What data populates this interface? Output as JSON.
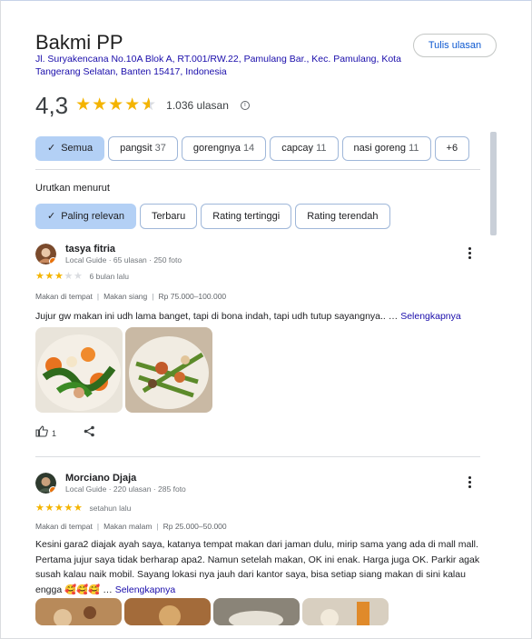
{
  "place": {
    "name": "Bakmi PP",
    "address": "Jl. Suryakencana No.10A Blok A, RT.001/RW.22, Pamulang Bar., Kec. Pamulang, Kota Tangerang Selatan, Banten 15417, Indonesia",
    "write_review_label": "Tulis ulasan",
    "rating": "4,3",
    "rating_value": 4.3,
    "review_count": "1.036 ulasan"
  },
  "filters": [
    {
      "label": "Semua",
      "count": "",
      "active": true
    },
    {
      "label": "pangsit",
      "count": "37"
    },
    {
      "label": "gorengnya",
      "count": "14"
    },
    {
      "label": "capcay",
      "count": "11"
    },
    {
      "label": "nasi goreng",
      "count": "11"
    },
    {
      "label": "+6",
      "count": ""
    }
  ],
  "sort": {
    "label": "Urutkan menurut",
    "options": [
      "Paling relevan",
      "Terbaru",
      "Rating tertinggi",
      "Rating terendah"
    ],
    "selected": "Paling relevan"
  },
  "reviews": [
    {
      "name": "tasya fitria",
      "meta": "Local Guide · 65 ulasan · 250 foto",
      "stars": 3,
      "date": "6 bulan lalu",
      "tags": [
        "Makan di tempat",
        "Makan siang",
        "Rp 75.000–100.000"
      ],
      "text": "Jujur gw makan ini udh lama banget, tapi di bona indah, tapi udh tutup sayangnya.. …",
      "more_label": "Selengkapnya",
      "likes": "1",
      "photos": [
        "capcay-photo",
        "green-vegetable-stirfry-photo"
      ]
    },
    {
      "name": "Morciano Djaja",
      "meta": "Local Guide · 220 ulasan · 285 foto",
      "stars": 5,
      "date": "setahun lalu",
      "tags": [
        "Makan di tempat",
        "Makan malam",
        "Rp 25.000–50.000"
      ],
      "text": "Kesini gara2 diajak ayah saya, katanya tempat makan dari jaman dulu, mirip sama yang ada di mall mall. Pertama jujur saya tidak berharap apa2. Namun setelah makan, OK ini enak. Harga juga OK. Parkir agak susah kalau naik mobil. Sayang lokasi nya jauh dari kantor saya, bisa setiap siang makan di sini kalau engga 🥰🥰🥰 …",
      "more_label": "Selengkapnya",
      "photos": [
        "food-photo-1",
        "food-photo-2",
        "food-photo-3",
        "food-photo-4"
      ]
    }
  ],
  "colors": {
    "star": "#f4b400",
    "active_chip": "#b3d0f5",
    "link": "#1a0dab",
    "button_text": "#0b57d0"
  }
}
